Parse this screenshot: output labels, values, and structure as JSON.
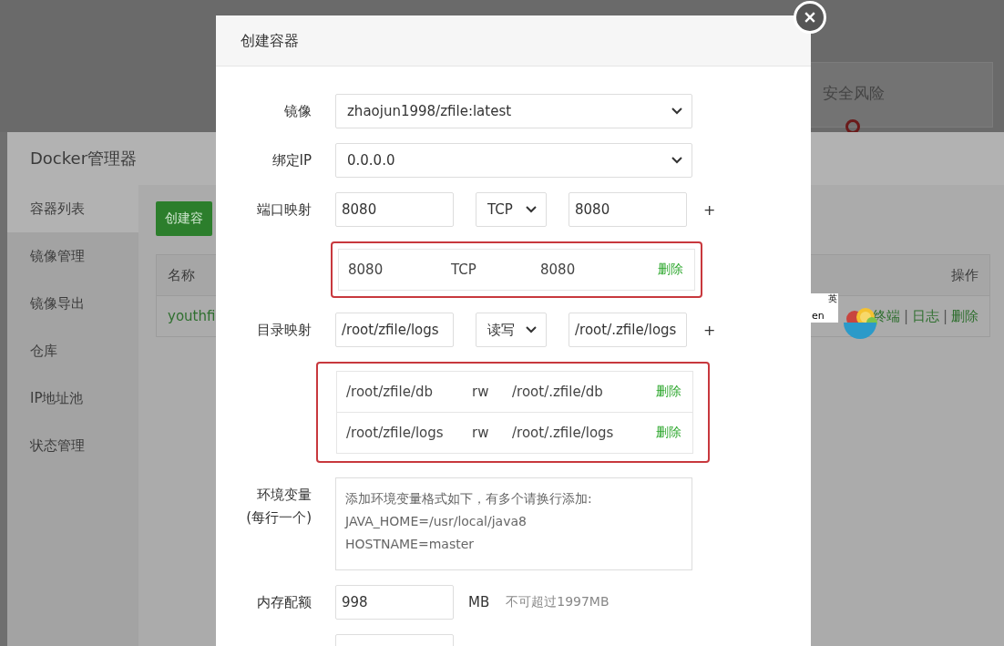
{
  "background": {
    "risk_card": {
      "title": "安全风险"
    },
    "docker_window": {
      "title": "Docker管理器",
      "sidebar": [
        {
          "label": "容器列表",
          "selected": true
        },
        {
          "label": "镜像管理",
          "selected": false
        },
        {
          "label": "镜像导出",
          "selected": false
        },
        {
          "label": "仓库",
          "selected": false
        },
        {
          "label": "IP地址池",
          "selected": false
        },
        {
          "label": "状态管理",
          "selected": false
        }
      ],
      "create_button": "创建容",
      "table": {
        "columns": [
          "名称",
          "操作"
        ],
        "rows": [
          {
            "name": "youthfi",
            "actions": [
              "终端",
              "日志",
              "删除"
            ],
            "separator": "|"
          }
        ]
      },
      "translate_badge": {
        "top": "英",
        "bottom": "en"
      }
    }
  },
  "dialog": {
    "title": "创建容器",
    "image": {
      "label": "镜像",
      "value": "zhaojun1998/zfile:latest"
    },
    "bind_ip": {
      "label": "绑定IP",
      "value": "0.0.0.0"
    },
    "port_map": {
      "label": "端口映射",
      "host": "8080",
      "protocol": "TCP",
      "container": "8080",
      "add": "+",
      "entries": [
        {
          "host": "8080",
          "protocol": "TCP",
          "container": "8080",
          "delete": "删除"
        }
      ]
    },
    "dir_map": {
      "label": "目录映射",
      "host": "/root/zfile/logs",
      "mode": "读写",
      "container": "/root/.zfile/logs",
      "add": "+",
      "entries": [
        {
          "host": "/root/zfile/db",
          "mode": "rw",
          "container": "/root/.zfile/db",
          "delete": "删除"
        },
        {
          "host": "/root/zfile/logs",
          "mode": "rw",
          "container": "/root/.zfile/logs",
          "delete": "删除"
        }
      ]
    },
    "env": {
      "label": "环境变量",
      "sublabel": "(每行一个)",
      "placeholder": "添加环境变量格式如下，有多个请换行添加:\nJAVA_HOME=/usr/local/java8\nHOSTNAME=master"
    },
    "memory": {
      "label": "内存配额",
      "value": "998",
      "unit": "MB",
      "hint": "不可超过1997MB"
    }
  }
}
